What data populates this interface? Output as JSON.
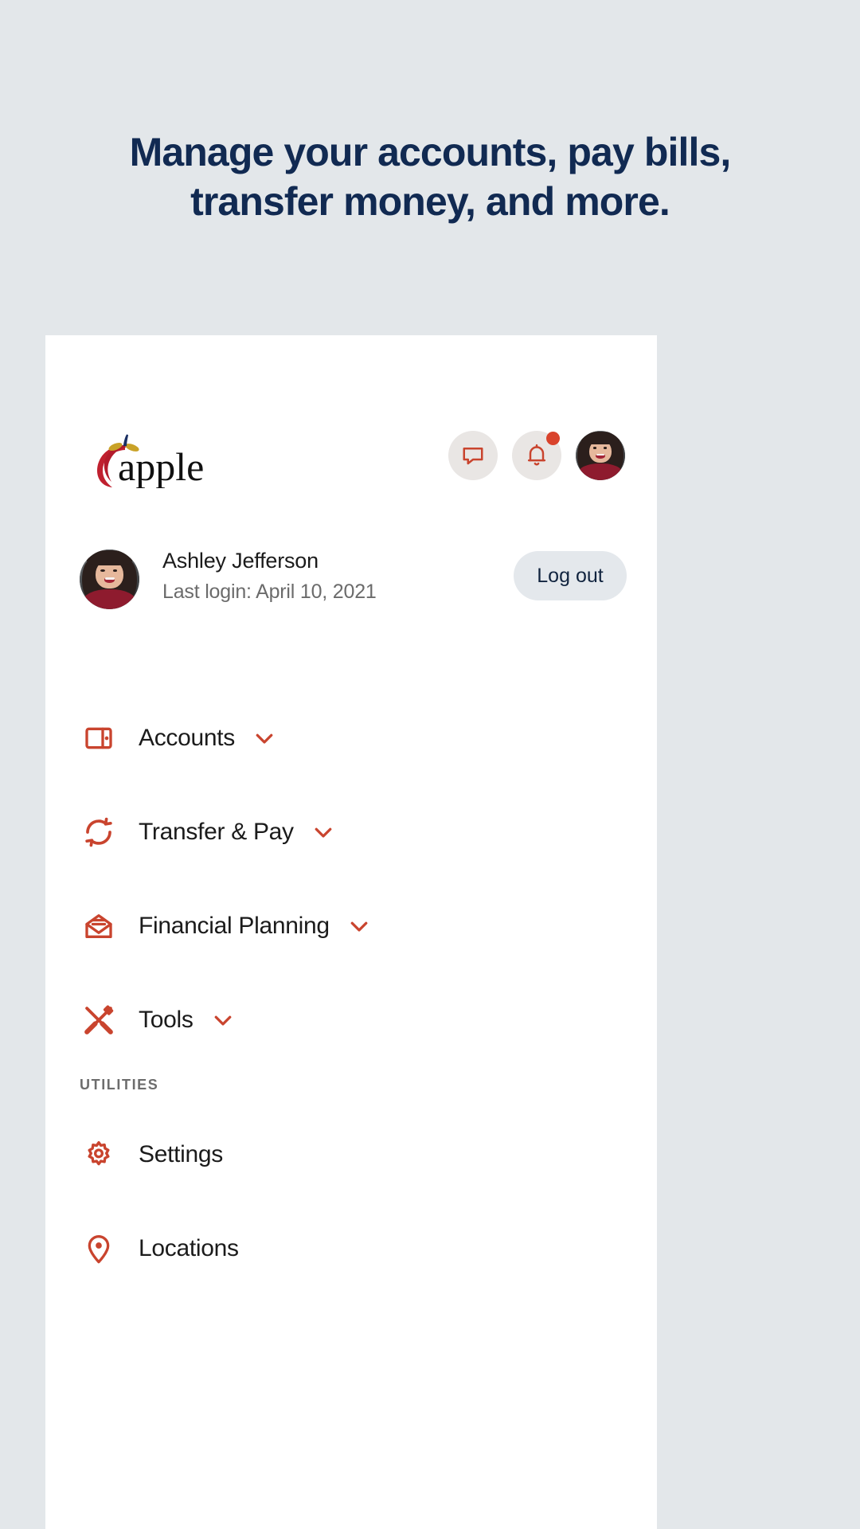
{
  "hero": {
    "line1": "Manage your accounts, pay bills,",
    "line2": "transfer money, and more."
  },
  "colors": {
    "page_background": "#e3e7ea",
    "card_background": "#ffffff",
    "heading_navy": "#112A52",
    "accent_red": "#c9442e",
    "badge_red": "#d9432c",
    "icon_circle_bg": "#e9e6e4",
    "logout_bg": "#e4e8ec",
    "logout_text": "#11243f",
    "muted_text": "#6b6b6b",
    "section_label": "#6d6d6d"
  },
  "topbar": {
    "logo_text": "apple",
    "actions": [
      {
        "name": "message-icon",
        "label": "Messages",
        "has_badge": false
      },
      {
        "name": "bell-icon",
        "label": "Notifications",
        "has_badge": true
      },
      {
        "name": "avatar",
        "label": "Account",
        "has_badge": false
      }
    ]
  },
  "user": {
    "name": "Ashley Jefferson",
    "last_login": "Last login: April 10, 2021",
    "logout_label": "Log out"
  },
  "nav": {
    "items": [
      {
        "label": "Accounts",
        "icon": "wallet-icon",
        "chevron": true
      },
      {
        "label": "Transfer & Pay",
        "icon": "transfer-icon",
        "chevron": true
      },
      {
        "label": "Financial Planning",
        "icon": "envelope-icon",
        "chevron": true
      },
      {
        "label": "Tools",
        "icon": "tools-icon",
        "chevron": true
      }
    ],
    "section_label": "UTILITIES",
    "utilities": [
      {
        "label": "Settings",
        "icon": "gear-icon",
        "chevron": false
      },
      {
        "label": "Locations",
        "icon": "location-pin-icon",
        "chevron": false
      }
    ]
  }
}
